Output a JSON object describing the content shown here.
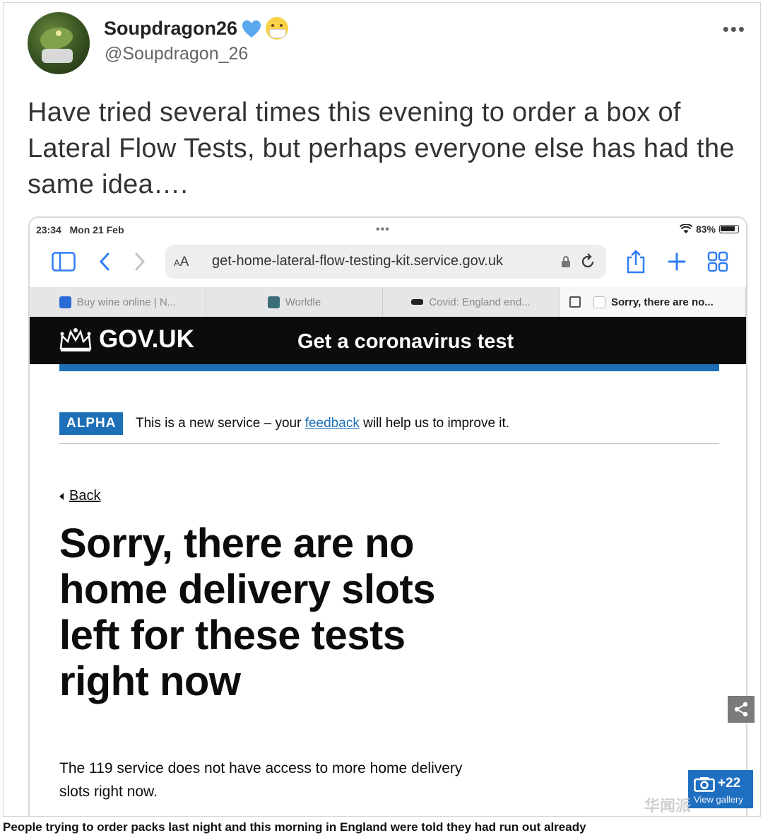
{
  "tweet": {
    "display_name": "Soupdragon26",
    "name_emojis": [
      "blue-heart",
      "face-with-medical-mask"
    ],
    "handle": "@Soupdragon_26",
    "more_icon": "more-horizontal-icon",
    "text": "Have tried several times this evening to order a box of Lateral Flow Tests, but perhaps everyone else has had the same idea…."
  },
  "screenshot": {
    "status_bar": {
      "time": "23:34",
      "date": "Mon 21 Feb",
      "dots": "•••",
      "battery": "83%"
    },
    "browser": {
      "aa_label": "AA",
      "url": "get-home-lateral-flow-testing-kit.service.gov.uk",
      "icons": [
        "sidebar-icon",
        "back-icon",
        "forward-icon",
        "lock-icon",
        "reload-icon",
        "share-icon",
        "new-tab-icon",
        "tabs-grid-icon"
      ],
      "tabs": [
        {
          "label": "Buy wine online | N...",
          "active": false
        },
        {
          "label": "Worldle",
          "active": false
        },
        {
          "label": "Covid: England end...",
          "active": false
        },
        {
          "label": "Sorry, there are no...",
          "active": true
        }
      ]
    },
    "gov_header": {
      "logo_text": "GOV.UK",
      "service_name": "Get a coronavirus test"
    },
    "phase_banner": {
      "tag": "ALPHA",
      "text_before": "This is a new service – your ",
      "link_text": "feedback",
      "text_after": " will help us to improve it."
    },
    "back_link": "Back",
    "heading": "Sorry, there are no home delivery slots left for these tests right now",
    "body": "The 119 service does not have access to more home delivery slots right now."
  },
  "overlays": {
    "gallery_count": "+22",
    "gallery_label": "View gallery",
    "watermark": "华闻派"
  },
  "caption": "People trying to order packs last night and this morning in England were told they had run out already",
  "colors": {
    "gov_black": "#0b0c0c",
    "gov_blue": "#1d70b8",
    "gallery_blue": "#1f6fc0",
    "heart_blue": "#5aa8ee"
  }
}
